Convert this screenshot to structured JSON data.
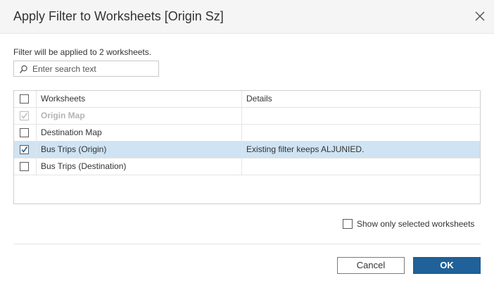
{
  "dialog": {
    "title": "Apply Filter to Worksheets [Origin Sz]",
    "close_icon": "close-icon"
  },
  "info_text": "Filter will be applied to 2 worksheets.",
  "search": {
    "placeholder": "Enter search text",
    "value": "",
    "icon": "search-icon"
  },
  "table": {
    "columns": [
      "Worksheets",
      "Details"
    ],
    "select_all_checked": false,
    "rows": [
      {
        "name": "Origin Map",
        "details": "",
        "checked": true,
        "disabled": true,
        "selected": false
      },
      {
        "name": "Destination Map",
        "details": "",
        "checked": false,
        "disabled": false,
        "selected": false
      },
      {
        "name": "Bus Trips (Origin)",
        "details": "Existing filter keeps ALJUNIED.",
        "checked": true,
        "disabled": false,
        "selected": true
      },
      {
        "name": "Bus Trips (Destination)",
        "details": "",
        "checked": false,
        "disabled": false,
        "selected": false
      }
    ]
  },
  "show_only_selected": {
    "label": "Show only selected worksheets",
    "checked": false
  },
  "buttons": {
    "cancel_label": "Cancel",
    "ok_label": "OK"
  },
  "colors": {
    "accent": "#1f6198",
    "selected_row": "#cfe3f3",
    "disabled_text": "#b4b4b4"
  }
}
